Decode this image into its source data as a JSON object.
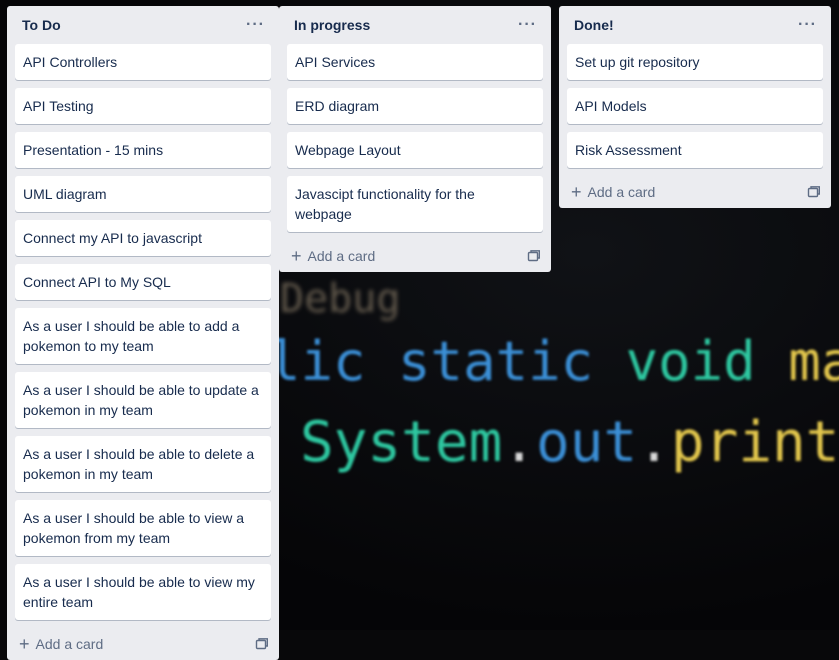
{
  "background": {
    "code_lines": [
      {
        "parts": [
          {
            "text": "Debug",
            "cls": ""
          }
        ]
      },
      {
        "parts": [
          {
            "text": "lic ",
            "cls": "blue"
          },
          {
            "text": "static ",
            "cls": "blue"
          },
          {
            "text": "void ",
            "cls": "teal"
          },
          {
            "text": "main",
            "cls": "yellow"
          }
        ]
      },
      {
        "parts": [
          {
            "text": "System",
            "cls": "teal"
          },
          {
            "text": ".",
            "cls": "white"
          },
          {
            "text": "out",
            "cls": "blue"
          },
          {
            "text": ".",
            "cls": "white"
          },
          {
            "text": "println",
            "cls": "yellow"
          }
        ]
      }
    ]
  },
  "lists": [
    {
      "title": "To Do",
      "menu_label": "···",
      "cards": [
        "API Controllers",
        "API Testing",
        "Presentation - 15 mins",
        "UML diagram",
        "Connect my API to javascript",
        "Connect API to My SQL",
        "As a user I should be able to add a pokemon to my team",
        "As a user I should be able to update a pokemon in my team",
        "As a user I should be able to delete a pokemon in my team",
        "As a user I should be able to view a pokemon from my team",
        "As a user I should be able to view my entire team"
      ],
      "add_card_label": "Add a card"
    },
    {
      "title": "In progress",
      "menu_label": "···",
      "cards": [
        "API Services",
        "ERD diagram",
        "Webpage Layout",
        "Javascipt functionality for the webpage"
      ],
      "add_card_label": "Add a card"
    },
    {
      "title": "Done!",
      "menu_label": "···",
      "cards": [
        "Set up git repository",
        "API Models",
        "Risk Assessment"
      ],
      "add_card_label": "Add a card"
    }
  ],
  "icons": {
    "plus": "plus-icon",
    "template": "card-template-icon",
    "menu": "list-menu-icon"
  },
  "colors": {
    "list_bg": "#ebecf0",
    "card_bg": "#ffffff",
    "text": "#172b4d",
    "muted": "#5e6c84"
  }
}
